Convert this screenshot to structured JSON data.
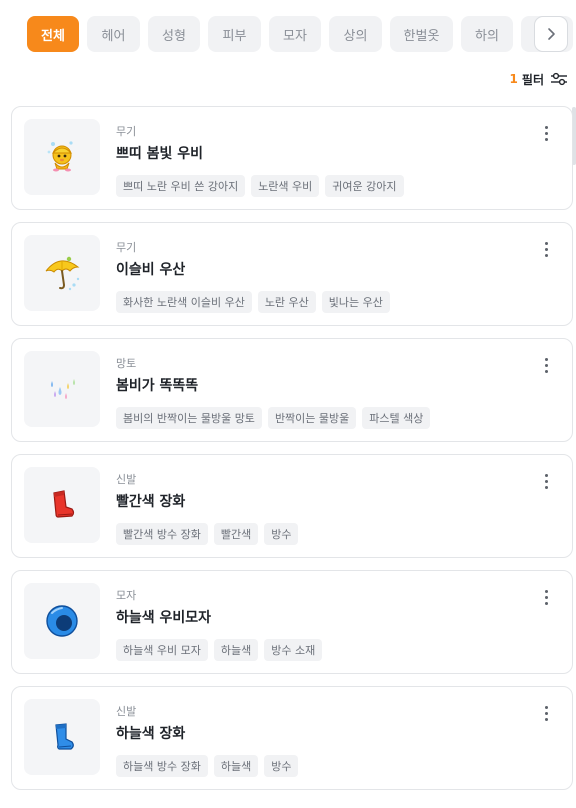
{
  "tabs": [
    {
      "label": "전체",
      "active": true
    },
    {
      "label": "헤어",
      "active": false
    },
    {
      "label": "성형",
      "active": false
    },
    {
      "label": "피부",
      "active": false
    },
    {
      "label": "모자",
      "active": false
    },
    {
      "label": "상의",
      "active": false
    },
    {
      "label": "한벌옷",
      "active": false
    },
    {
      "label": "하의",
      "active": false
    }
  ],
  "filter": {
    "count": "1",
    "label": "필터"
  },
  "items": [
    {
      "category": "무기",
      "title": "쁘띠 봄빛 우비",
      "icon": "yellow-raincoat-chick-icon",
      "tags": [
        "쁘띠 노란 우비 쓴 강아지",
        "노란색 우비",
        "귀여운 강아지"
      ]
    },
    {
      "category": "무기",
      "title": "이슬비 우산",
      "icon": "yellow-umbrella-icon",
      "tags": [
        "화사한 노란색 이슬비 우산",
        "노란 우산",
        "빛나는 우산"
      ]
    },
    {
      "category": "망토",
      "title": "봄비가 똑똑똑",
      "icon": "raindrops-cape-icon",
      "tags": [
        "봄비의 반짝이는 물방울 망토",
        "반짝이는 물방울",
        "파스텔 색상"
      ]
    },
    {
      "category": "신발",
      "title": "빨간색 장화",
      "icon": "red-boots-icon",
      "tags": [
        "빨간색 방수 장화",
        "빨간색",
        "방수"
      ]
    },
    {
      "category": "모자",
      "title": "하늘색 우비모자",
      "icon": "blue-rain-hat-icon",
      "tags": [
        "하늘색 우비 모자",
        "하늘색",
        "방수 소재"
      ]
    },
    {
      "category": "신발",
      "title": "하늘색 장화",
      "icon": "blue-boots-icon",
      "tags": [
        "하늘색 방수 장화",
        "하늘색",
        "방수"
      ]
    }
  ],
  "colors": {
    "accent": "#f7891b",
    "tag_bg": "#f1f2f4",
    "border": "#e3e5e8"
  }
}
